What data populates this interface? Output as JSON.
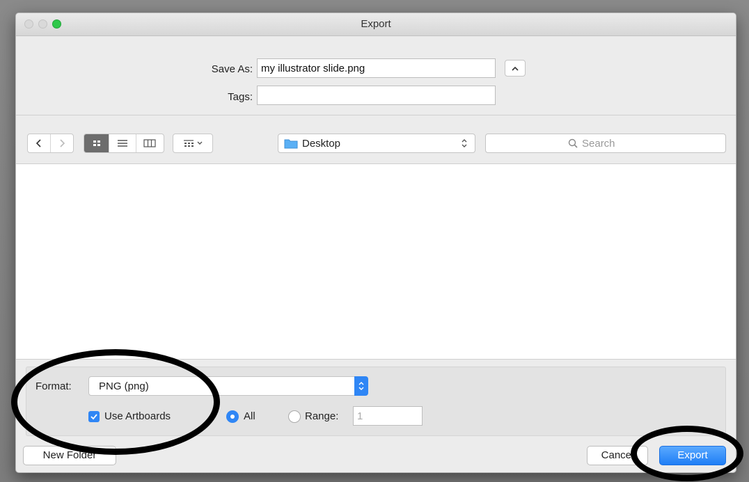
{
  "window": {
    "title": "Export"
  },
  "save": {
    "save_as_label": "Save As:",
    "filename": "my illustrator slide.png",
    "tags_label": "Tags:",
    "tags_value": ""
  },
  "toolbar": {
    "location": "Desktop",
    "search_placeholder": "Search"
  },
  "options": {
    "format_label": "Format:",
    "format_value": "PNG (png)",
    "use_artboards_label": "Use Artboards",
    "use_artboards_checked": true,
    "all_label": "All",
    "range_label": "Range:",
    "range_value": "1"
  },
  "footer": {
    "new_folder_label": "New Folder",
    "cancel_label": "Cancel",
    "export_label": "Export"
  },
  "colors": {
    "accent": "#1f7ef5",
    "zoom_button": "#2fc84a",
    "annotation": "#000000"
  }
}
